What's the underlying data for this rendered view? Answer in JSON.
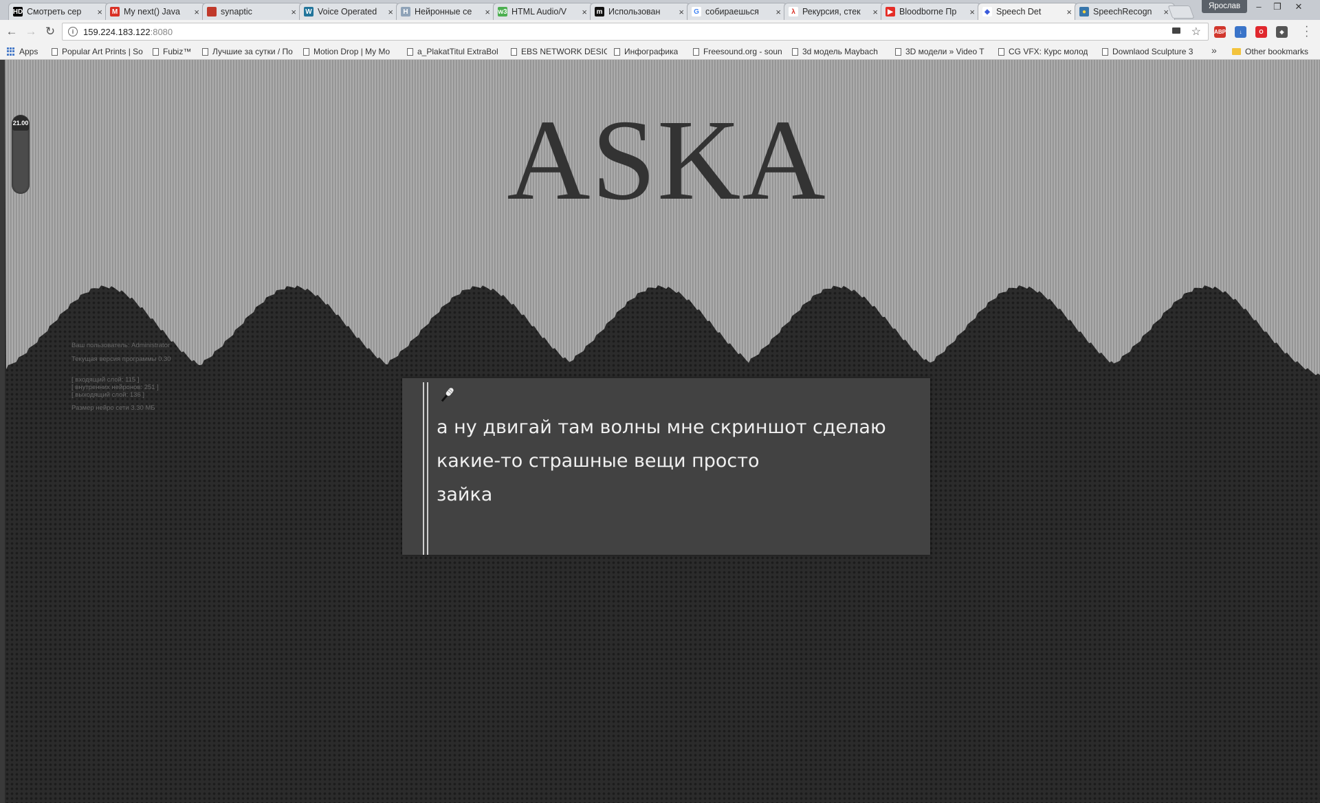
{
  "browser": {
    "tabs": [
      {
        "title": "Смотреть сер",
        "favicon": "HD",
        "color": "#000000",
        "fg": "#ffffff",
        "active": false
      },
      {
        "title": "My next() Java",
        "favicon": "M",
        "color": "#d93025",
        "fg": "#ffffff",
        "active": false
      },
      {
        "title": "synaptic",
        "favicon": "",
        "color": "#c0392b",
        "fg": "#ffffff",
        "active": false
      },
      {
        "title": "Voice Operated",
        "favicon": "W",
        "color": "#21759b",
        "fg": "#ffffff",
        "active": false
      },
      {
        "title": "Нейронные се",
        "favicon": "H",
        "color": "#8fa3b8",
        "fg": "#ffffff",
        "active": false
      },
      {
        "title": "HTML Audio/V",
        "favicon": "w3",
        "color": "#4caf50",
        "fg": "#ffffff",
        "active": false
      },
      {
        "title": "Использован",
        "favicon": "m",
        "color": "#111111",
        "fg": "#ffffff",
        "active": false
      },
      {
        "title": "собираешься",
        "favicon": "G",
        "color": "#ffffff",
        "fg": "#4285f4",
        "active": false
      },
      {
        "title": "Рекурсия, стек",
        "favicon": "λ",
        "color": "#ffffff",
        "fg": "#d93025",
        "active": false
      },
      {
        "title": "Bloodborne Пр",
        "favicon": "▶",
        "color": "#e52d27",
        "fg": "#ffffff",
        "active": false
      },
      {
        "title": "Speech Det",
        "favicon": "◆",
        "color": "#ffffff",
        "fg": "#3b5bdb",
        "active": true
      },
      {
        "title": "SpeechRecogn",
        "favicon": "●",
        "color": "#3776ab",
        "fg": "#ffd43b",
        "active": false
      }
    ],
    "tab_close": "×",
    "profile_name": "Ярослав",
    "window_buttons": {
      "minimize": "–",
      "restore": "❐",
      "close": "✕"
    },
    "nav": {
      "back": "←",
      "forward": "→",
      "reload": "↻"
    },
    "url_host": "159.224.183.122",
    "url_port": ":8080",
    "star": "☆",
    "extensions": [
      {
        "name": "abp-icon",
        "label": "ABP",
        "color": "#d1372d"
      },
      {
        "name": "download-icon",
        "label": "↓",
        "color": "#3a74c9"
      },
      {
        "name": "opera-icon",
        "label": "O",
        "color": "#e0282e"
      },
      {
        "name": "shield-icon",
        "label": "◈",
        "color": "#555555"
      }
    ],
    "bookmarks": [
      {
        "label": "Apps",
        "kind": "apps"
      },
      {
        "label": "Popular Art Prints | So",
        "kind": "page"
      },
      {
        "label": "Fubiz™",
        "kind": "page"
      },
      {
        "label": "Лучшие за сутки / По",
        "kind": "page"
      },
      {
        "label": "Motion Drop | My Mo",
        "kind": "page"
      },
      {
        "label": "a_PlakatTitul ExtraBol",
        "kind": "page"
      },
      {
        "label": "EBS NETWORK DESIG",
        "kind": "page"
      },
      {
        "label": "Инфографика",
        "kind": "page"
      },
      {
        "label": "Freesound.org - soun",
        "kind": "page"
      },
      {
        "label": "3d модель Maybach",
        "kind": "page"
      },
      {
        "label": "3D модели » Video T",
        "kind": "page"
      },
      {
        "label": "CG VFX: Курс молод",
        "kind": "page"
      },
      {
        "label": "Downlaod Sculpture 3",
        "kind": "page"
      }
    ],
    "bookmarks_more": "»",
    "other_bookmarks": "Other bookmarks"
  },
  "page": {
    "logo": "ASKA",
    "slider_value": "21.00",
    "info": {
      "user": "Ваш пользователь: Administrator",
      "version": "Текущая версия программы 0.30",
      "input_layer": "[ входящий слой: 115 ]",
      "hidden_neurons": "[ внутренних нейронов: 251 ]",
      "output_layer": "[ выходящий слой: 136 ]",
      "net_size": "Размер нейро сети 3.30 МБ"
    },
    "speech": {
      "mic_icon": "microphone-icon",
      "lines": [
        "а ну двигай там волны мне скриншот сделаю",
        "какие-то страшные вещи просто",
        "зайка"
      ]
    },
    "colors": {
      "wave_light": "#a9a9a9",
      "wave_stripe": "#8f8f8f",
      "dark_bg": "#2b2b2b",
      "panel": "#424242"
    }
  }
}
